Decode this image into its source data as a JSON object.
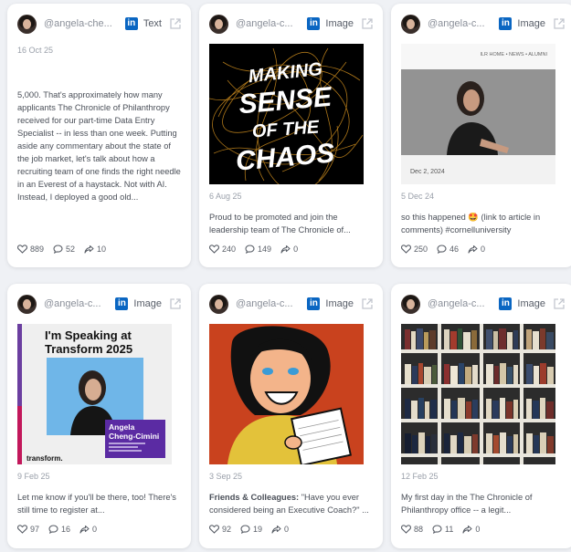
{
  "posts": [
    {
      "handle": "@angela-che...",
      "type": "Text",
      "date": "16 Oct 25",
      "text": "5,000. That's approximately how many applicants The Chronicle of Philanthropy received for our part-time Data Entry Specialist -- in less than one week. Putting aside any commentary about the state of the job market, let's talk about how a recruiting team of one finds the right needle in an Everest of a haystack. Not with AI. Instead, I deployed a good old...",
      "likes": "889",
      "comments": "52",
      "shares": "10"
    },
    {
      "handle": "@angela-c...",
      "type": "Image",
      "image_text": [
        "MAKING",
        "SENSE",
        "OF THE",
        "CHAOS"
      ],
      "date": "6 Aug 25",
      "text": "Proud to be promoted and join the leadership team of The Chronicle of...",
      "likes": "240",
      "comments": "149",
      "shares": "0"
    },
    {
      "handle": "@angela-c...",
      "type": "Image",
      "image_text": [
        "ILR HOME • NEWS • ALUMNI",
        "Dec 2, 2024"
      ],
      "date": "5 Dec 24",
      "text": "so this happened 🤩 (link to article in comments) #cornelluniversity",
      "likes": "250",
      "comments": "46",
      "shares": "0"
    },
    {
      "handle": "@angela-c...",
      "type": "Image",
      "image_text": [
        "I'm Speaking at",
        "Transform 2025",
        "Angela",
        "Cheng-Cimini",
        "transform."
      ],
      "date": "9 Feb 25",
      "text": "Let me know if you'll be there, too! There's still time to register at...",
      "likes": "97",
      "comments": "16",
      "shares": "0"
    },
    {
      "handle": "@angela-c...",
      "type": "Image",
      "date": "3 Sep 25",
      "text_bold": "Friends & Colleagues:",
      "text": "\"Have you ever considered being an Executive Coach?\" ...",
      "likes": "92",
      "comments": "19",
      "shares": "0"
    },
    {
      "handle": "@angela-c...",
      "type": "Image",
      "date": "12 Feb 25",
      "text": "My first day in the The Chronicle of Philanthropy office -- a legit...",
      "likes": "88",
      "comments": "11",
      "shares": "0"
    }
  ],
  "icons": {
    "linkedin": "in",
    "external": "external-link-icon",
    "like": "heart-icon",
    "comment": "comment-icon",
    "share": "share-icon"
  },
  "colors": {
    "linkedin": "#0a66c2",
    "background": "#eff1f5"
  }
}
